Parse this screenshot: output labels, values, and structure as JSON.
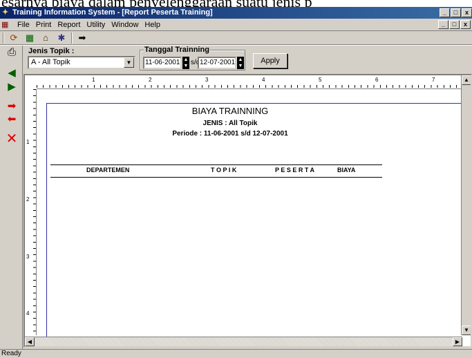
{
  "background_caption": "esarnya biaya dalam penyelenggaraan suatu jenis p",
  "window": {
    "title": "Training Information System - [Report Peserta Training]",
    "controls": [
      "_",
      "□",
      "x"
    ],
    "inner_controls": [
      "_",
      "□",
      "x"
    ]
  },
  "menu": [
    "File",
    "Print",
    "Report",
    "Utility",
    "Window",
    "Help"
  ],
  "toolbar_icons": [
    "refresh-icon",
    "save-icon",
    "bank-icon",
    "runner-icon",
    "exit-icon"
  ],
  "side_icons": [
    "printer-icon",
    "first-icon",
    "last-icon",
    "next-icon",
    "prev-icon",
    "close-icon"
  ],
  "filter": {
    "jenis_label": "Jenis Topik :",
    "jenis_value": "A - All Topik",
    "tanggal_label": "Tanggal Trainning",
    "date_from": "11-06-2001",
    "sd": "s/d",
    "date_to": "12-07-2001",
    "apply": "Apply"
  },
  "ruler": {
    "h": [
      "1",
      "2",
      "3",
      "4",
      "5",
      "6",
      "7"
    ],
    "v": [
      "1",
      "2",
      "3",
      "4"
    ]
  },
  "report": {
    "title": "BIAYA TRAINNING",
    "jenis": "JENIS : All Topik",
    "periode": "Periode : 11-06-2001 s/d 12-07-2001",
    "columns": [
      "DEPARTEMEN",
      "T O P I K",
      "P E S E R T A",
      "BIAYA"
    ]
  },
  "status": "Ready"
}
